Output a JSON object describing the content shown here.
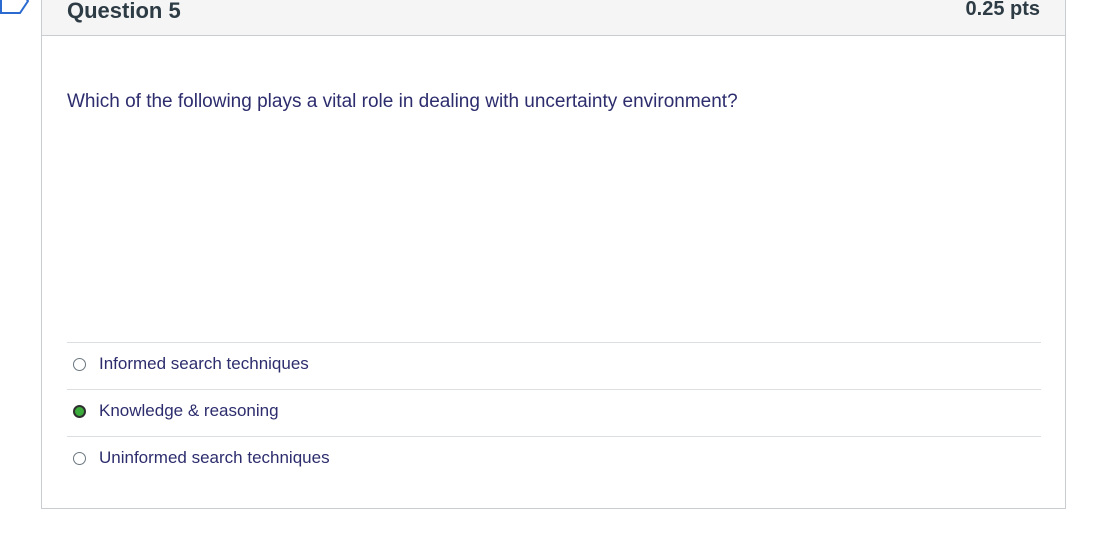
{
  "question": {
    "title": "Question 5",
    "points": "0.25 pts",
    "text": "Which of the following plays a vital role in dealing with uncertainty environment?"
  },
  "answers": [
    {
      "label": "Informed search techniques",
      "selected": false
    },
    {
      "label": "Knowledge & reasoning",
      "selected": true
    },
    {
      "label": "Uninformed search techniques",
      "selected": false
    }
  ],
  "colors": {
    "selected_radio": "#3bab3b",
    "text": "#2d2d6e",
    "header_bg": "#f5f5f5"
  }
}
